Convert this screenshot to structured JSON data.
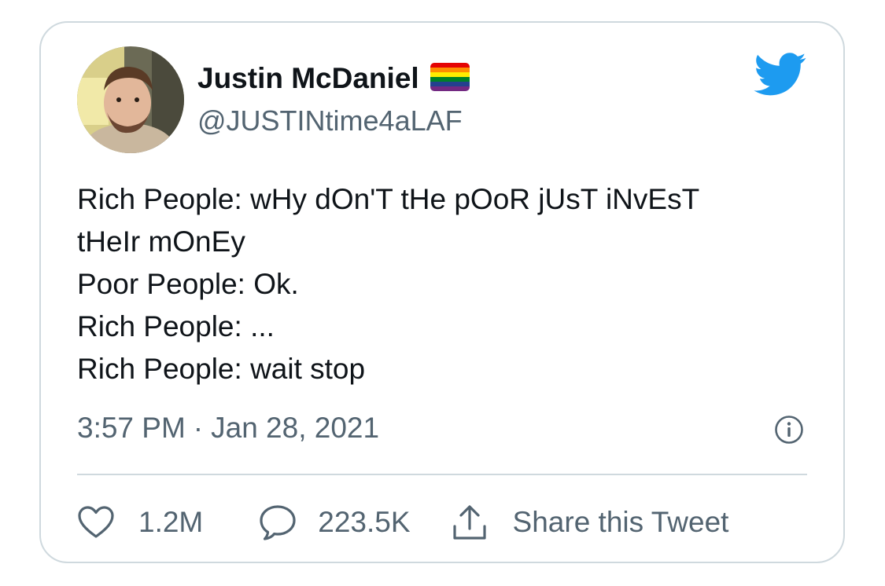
{
  "author": {
    "display_name": "Justin McDaniel",
    "handle": "@JUSTINtime4aLAF",
    "flag_emoji": "rainbow-flag-icon"
  },
  "tweet": {
    "lines": [
      "Rich People: wHy dOn'T tHe pOoR jUsT iNvEsT",
      "tHeIr mOnEy",
      "Poor People: Ok.",
      "Rich People: ...",
      "Rich People: wait stop"
    ],
    "time": "3:57 PM",
    "separator": "·",
    "date": "Jan 28, 2021"
  },
  "actions": {
    "likes": "1.2M",
    "replies": "223.5K",
    "share_label": "Share this Tweet"
  },
  "colors": {
    "brand_blue": "#1d9bf0",
    "text_primary": "#0f1419",
    "text_secondary": "#536471",
    "border": "#cfd9de"
  }
}
